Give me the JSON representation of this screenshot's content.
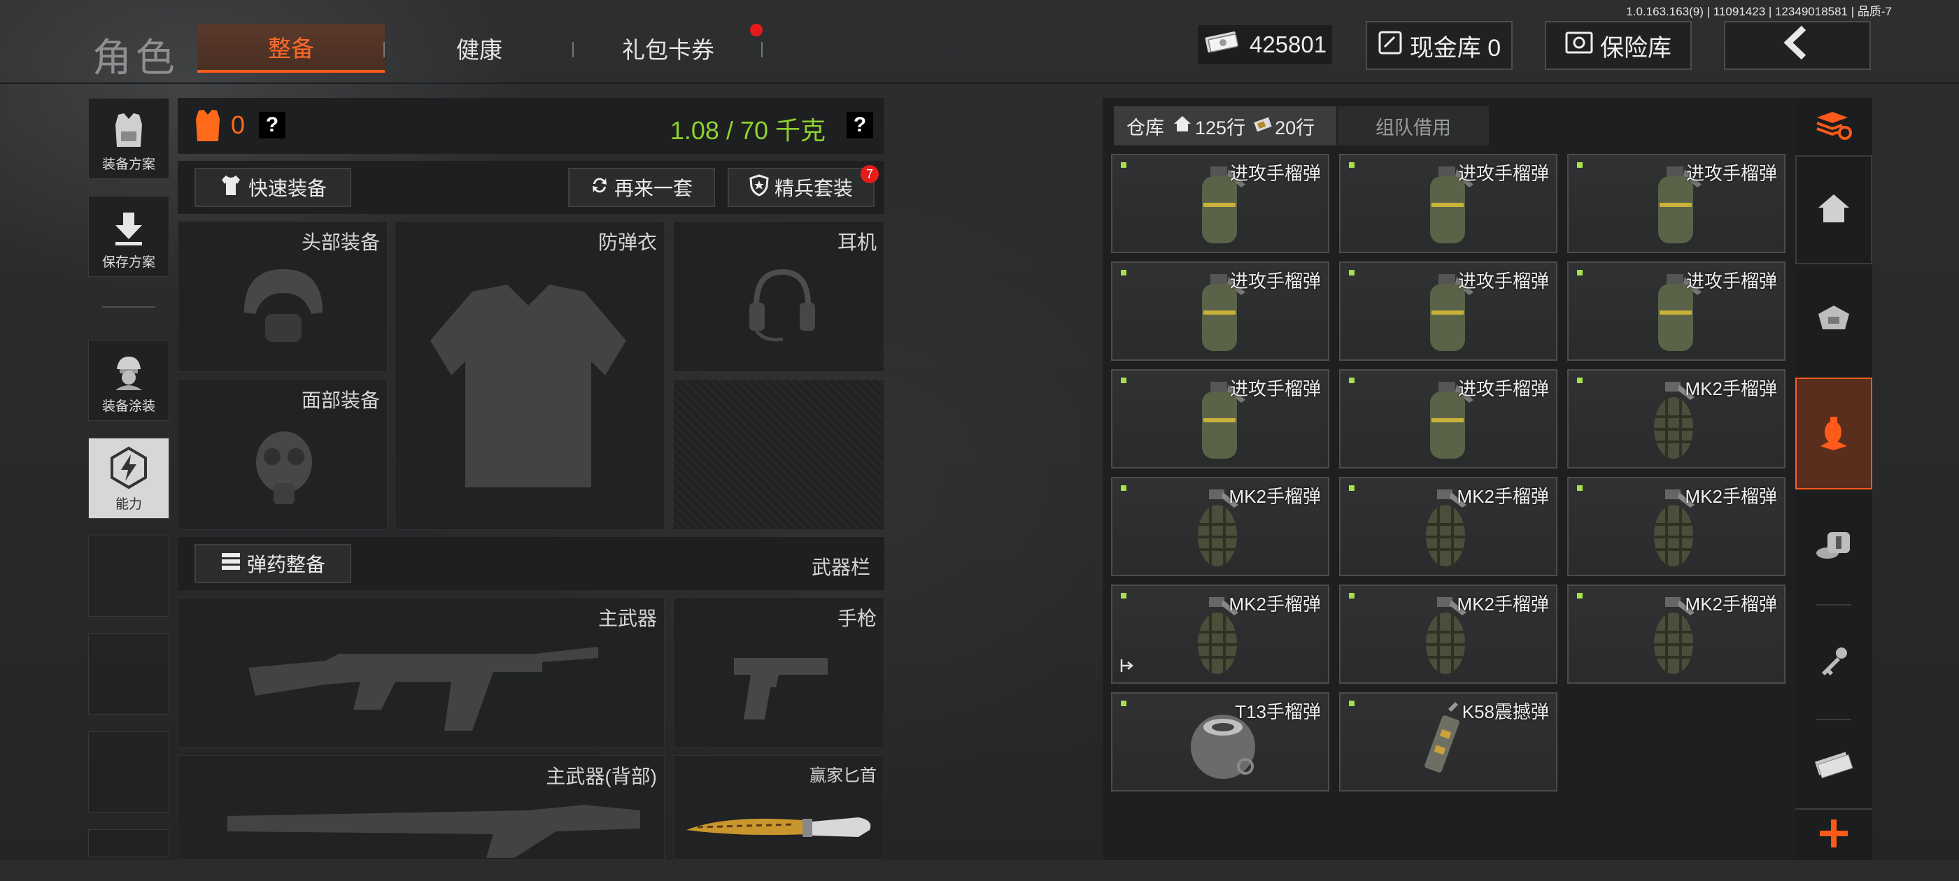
{
  "version": "1.0.163.163(9) | 11091423 | 12349018581 | 品质-7",
  "header": {
    "title": "角色",
    "tabs": [
      {
        "label": "整备",
        "active": true
      },
      {
        "label": "健康",
        "active": false
      },
      {
        "label": "礼包卡券",
        "active": false,
        "badge": true
      }
    ],
    "money": "425801",
    "cash_vault_label": "现金库 0",
    "safe_label": "保险库"
  },
  "left_menu": [
    {
      "label": "装备方案",
      "icon": "vest-icon"
    },
    {
      "label": "保存方案",
      "icon": "download-icon"
    },
    {
      "label": "装备涂装",
      "icon": "soldier-icon"
    },
    {
      "label": "能力",
      "icon": "lightning-icon"
    }
  ],
  "equipment": {
    "armor_count": "0",
    "weight": "1.08 / 70 千克",
    "help": "?",
    "quick_equip": "快速装备",
    "reequip": "再来一套",
    "elite_set": "精兵套装",
    "elite_badge": "7",
    "slots": {
      "head": "头部装备",
      "armor": "防弹衣",
      "headset": "耳机",
      "face": "面部装备"
    },
    "ammo_equip": "弹药整备",
    "weapon_bar": "武器栏",
    "weapons": {
      "primary": "主武器",
      "pistol": "手枪",
      "primary_back": "主武器(背部)",
      "knife": "赢家匕首"
    }
  },
  "inventory": {
    "tabs": {
      "warehouse": "仓库",
      "rows_a": "125行",
      "rows_b": "20行",
      "team_borrow": "组队借用"
    },
    "items": [
      {
        "name": "进攻手榴弹",
        "type": "offensive"
      },
      {
        "name": "进攻手榴弹",
        "type": "offensive"
      },
      {
        "name": "进攻手榴弹",
        "type": "offensive"
      },
      {
        "name": "进攻手榴弹",
        "type": "offensive"
      },
      {
        "name": "进攻手榴弹",
        "type": "offensive"
      },
      {
        "name": "进攻手榴弹",
        "type": "offensive"
      },
      {
        "name": "进攻手榴弹",
        "type": "offensive"
      },
      {
        "name": "进攻手榴弹",
        "type": "offensive"
      },
      {
        "name": "MK2手榴弹",
        "type": "mk2"
      },
      {
        "name": "MK2手榴弹",
        "type": "mk2"
      },
      {
        "name": "MK2手榴弹",
        "type": "mk2"
      },
      {
        "name": "MK2手榴弹",
        "type": "mk2"
      },
      {
        "name": "MK2手榴弹",
        "type": "mk2"
      },
      {
        "name": "MK2手榴弹",
        "type": "mk2"
      },
      {
        "name": "MK2手榴弹",
        "type": "mk2"
      },
      {
        "name": "T13手榴弹",
        "type": "t13"
      },
      {
        "name": "K58震撼弹",
        "type": "k58"
      }
    ]
  },
  "colors": {
    "accent": "#ff5a1a",
    "weight": "#8fd12e",
    "badge": "#e81b1b"
  }
}
